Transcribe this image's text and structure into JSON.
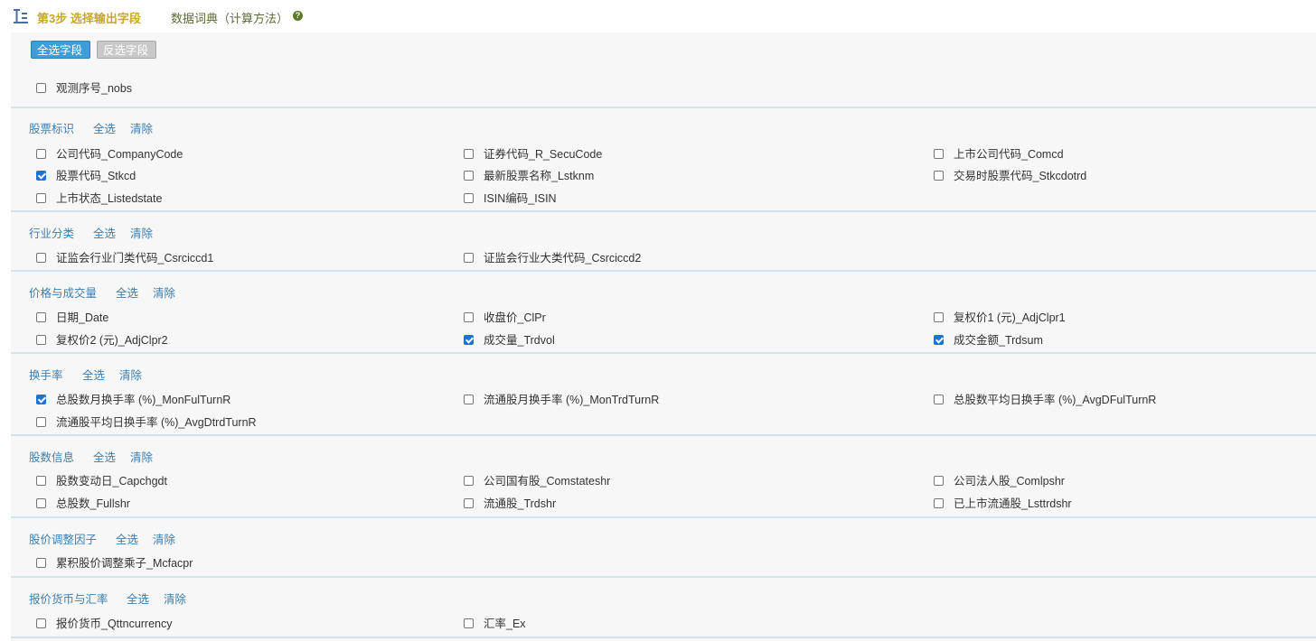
{
  "header": {
    "step_title": "第3步 选择输出字段",
    "dictionary_link": "数据词典（计算方法）",
    "help_glyph": "?",
    "icon": "text-format-icon",
    "accent_color": "#c8a62a"
  },
  "buttons": {
    "select_all": "全选字段",
    "invert": "反选字段"
  },
  "standalone": {
    "label": "观测序号_nobs",
    "checked": false
  },
  "group_actions": {
    "select_all": "全选",
    "clear": "清除"
  },
  "groups": [
    {
      "title": "股票标识",
      "fields": [
        {
          "label": "公司代码_CompanyCode",
          "checked": false
        },
        {
          "label": "证券代码_R_SecuCode",
          "checked": false
        },
        {
          "label": "上市公司代码_Comcd",
          "checked": false
        },
        {
          "label": "股票代码_Stkcd",
          "checked": true
        },
        {
          "label": "最新股票名称_Lstknm",
          "checked": false
        },
        {
          "label": "交易时股票代码_Stkcdotrd",
          "checked": false
        },
        {
          "label": "上市状态_Listedstate",
          "checked": false
        },
        {
          "label": "ISIN编码_ISIN",
          "checked": false
        }
      ]
    },
    {
      "title": "行业分类",
      "fields": [
        {
          "label": "证监会行业门类代码_Csrciccd1",
          "checked": false
        },
        {
          "label": "证监会行业大类代码_Csrciccd2",
          "checked": false
        }
      ]
    },
    {
      "title": "价格与成交量",
      "fields": [
        {
          "label": "日期_Date",
          "checked": false
        },
        {
          "label": "收盘价_ClPr",
          "checked": false
        },
        {
          "label": "复权价1 (元)_AdjClpr1",
          "checked": false
        },
        {
          "label": "复权价2 (元)_AdjClpr2",
          "checked": false
        },
        {
          "label": "成交量_Trdvol",
          "checked": true
        },
        {
          "label": "成交金额_Trdsum",
          "checked": true
        }
      ]
    },
    {
      "title": "换手率",
      "fields": [
        {
          "label": "总股数月换手率 (%)_MonFulTurnR",
          "checked": true
        },
        {
          "label": "流通股月换手率 (%)_MonTrdTurnR",
          "checked": false
        },
        {
          "label": "总股数平均日换手率 (%)_AvgDFulTurnR",
          "checked": false
        },
        {
          "label": "流通股平均日换手率 (%)_AvgDtrdTurnR",
          "checked": false
        }
      ]
    },
    {
      "title": "股数信息",
      "fields": [
        {
          "label": "股数变动日_Capchgdt",
          "checked": false
        },
        {
          "label": "公司国有股_Comstateshr",
          "checked": false
        },
        {
          "label": "公司法人股_Comlpshr",
          "checked": false
        },
        {
          "label": "总股数_Fullshr",
          "checked": false
        },
        {
          "label": "流通股_Trdshr",
          "checked": false
        },
        {
          "label": "已上市流通股_Lsttrdshr",
          "checked": false
        }
      ]
    },
    {
      "title": "股价调整因子",
      "fields": [
        {
          "label": "累积股价调整乘子_Mcfacpr",
          "checked": false
        }
      ]
    },
    {
      "title": "报价货币与汇率",
      "fields": [
        {
          "label": "报价货币_Qttncurrency",
          "checked": false
        },
        {
          "label": "汇率_Ex",
          "checked": false
        }
      ]
    }
  ]
}
